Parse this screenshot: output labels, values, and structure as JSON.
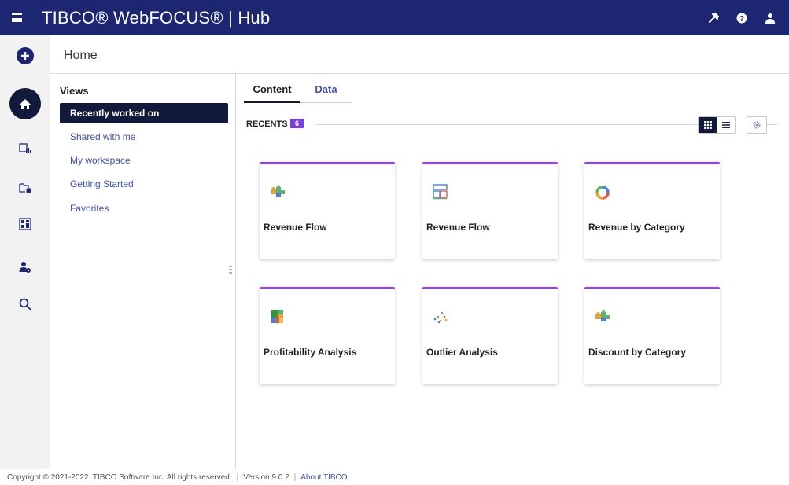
{
  "app": {
    "brand": "TIBCO® WebFOCUS® | Hub"
  },
  "topbar": {
    "icons": [
      "menu-icon",
      "tools-icon",
      "help-icon",
      "user-icon"
    ]
  },
  "rail": {
    "icons": [
      "plus-icon",
      "home-icon",
      "chart-icon",
      "folder-data-icon",
      "dashboard-icon",
      "user-settings-icon",
      "search-icon"
    ]
  },
  "header": {
    "title": "Home"
  },
  "views": {
    "title": "Views",
    "items": [
      {
        "label": "Recently worked on",
        "active": true
      },
      {
        "label": "Shared with me",
        "active": false
      },
      {
        "label": "My workspace",
        "active": false
      },
      {
        "label": "Getting Started",
        "active": false
      },
      {
        "label": "Favorites",
        "active": false
      }
    ]
  },
  "tabs": [
    {
      "label": "Content",
      "active": true
    },
    {
      "label": "Data",
      "active": false
    }
  ],
  "recents": {
    "label": "RECENTS",
    "count": "6"
  },
  "cards": [
    {
      "label": "Revenue Flow",
      "icon": "puzzle-icon"
    },
    {
      "label": "Revenue Flow",
      "icon": "report-layout-icon"
    },
    {
      "label": "Revenue by Category",
      "icon": "donut-chart-icon"
    },
    {
      "label": "Profitability Analysis",
      "icon": "treemap-icon"
    },
    {
      "label": "Outlier Analysis",
      "icon": "scatter-plot-icon"
    },
    {
      "label": "Discount by Category",
      "icon": "puzzle-icon"
    }
  ],
  "footer": {
    "copyright": "Copyright © 2021-2022. TIBCO Software Inc. All rights reserved.",
    "version": "Version 9.0.2",
    "about": "About TIBCO"
  },
  "colors": {
    "topbar": "#1d2670",
    "accent": "#8e44ec",
    "active_nav": "#111a3a",
    "link": "#4051b5"
  }
}
